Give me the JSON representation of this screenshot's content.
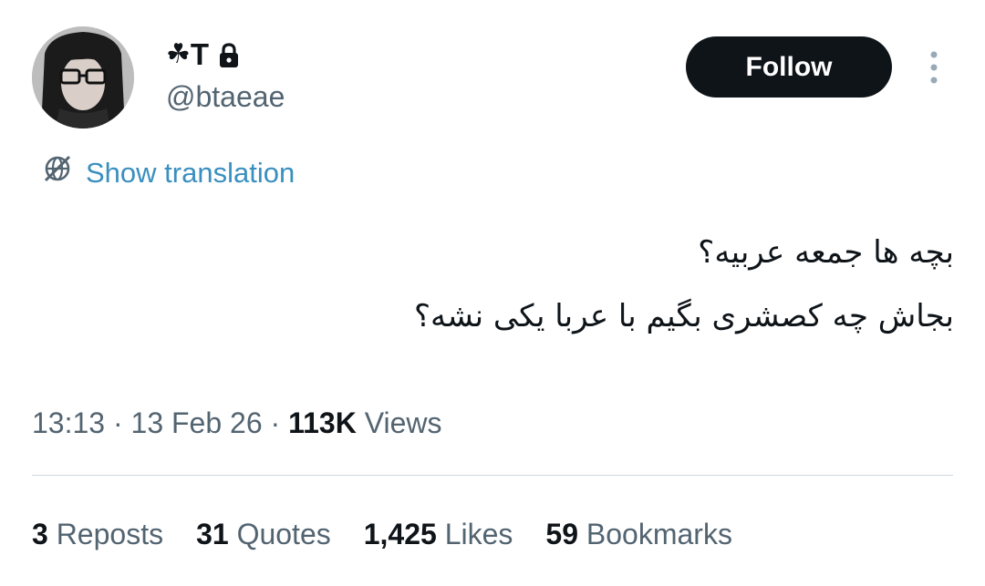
{
  "profile": {
    "display_name_symbol": "☘",
    "display_name": "T",
    "handle": "@btaeae",
    "avatar_icon": "avatar-photo",
    "protected_icon": "lock-icon"
  },
  "follow_button": {
    "label": "Follow"
  },
  "more_menu": {
    "icon": "more-vertical-icon"
  },
  "translation": {
    "label": "Show translation",
    "icon": "globe-slash-icon"
  },
  "tweet": {
    "lines": [
      "بچه ها جمعه عربیه؟",
      "بجاش چه کصشری بگیم با عربا یکی نشه؟"
    ]
  },
  "meta": {
    "time": "13:13",
    "sep1": " · ",
    "date": "13 Feb 26",
    "sep2": " · ",
    "views_count": "113K",
    "views_label": " Views"
  },
  "stats": {
    "reposts": {
      "count": "3",
      "label": " Reposts"
    },
    "quotes": {
      "count": "31",
      "label": " Quotes"
    },
    "likes": {
      "count": "1,425",
      "label": " Likes"
    },
    "bookmarks": {
      "count": "59",
      "label": " Bookmarks"
    }
  },
  "colors": {
    "text": "#0f1419",
    "muted": "#536471",
    "link": "#3a8fc0",
    "button_bg": "#0f1419",
    "divider": "#cfd9de"
  }
}
